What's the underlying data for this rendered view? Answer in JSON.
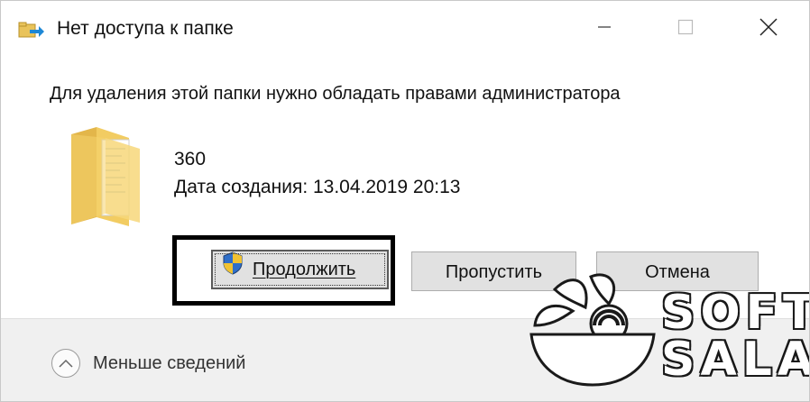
{
  "window": {
    "title": "Нет доступа к папке",
    "icon": "folder-move-icon",
    "controls": [
      "minimize-icon",
      "maximize-icon",
      "close-icon"
    ]
  },
  "dialog": {
    "message": "Для удаления этой папки нужно обладать правами администратора",
    "item": {
      "icon": "folder-icon",
      "name": "360",
      "date_created": "Дата создания: 13.04.2019 20:13"
    },
    "buttons": {
      "continue": "Продолжить",
      "continue_icon": "uac-shield-icon",
      "skip": "Пропустить",
      "cancel": "Отмена"
    }
  },
  "footer": {
    "details_label": "Меньше сведений",
    "details_icon": "chevron-up-icon"
  },
  "watermark": {
    "line1": "SOFT",
    "line2": "SALAD"
  },
  "colors": {
    "button_face": "#e1e1e1",
    "footer_bg": "#f0f0f0",
    "folder_yellow": "#f5d36e",
    "highlight_frame": "#000000"
  }
}
